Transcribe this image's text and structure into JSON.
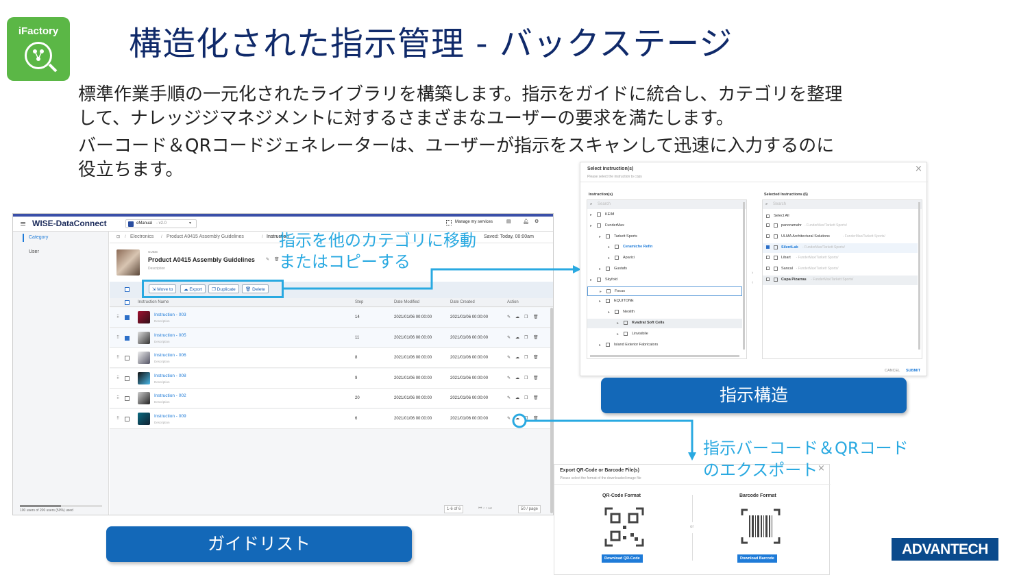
{
  "header": {
    "logo_text": "iFactory",
    "title": "構造化された指示管理 - バックステージ",
    "desc_line1": "標準作業手順の一元化されたライブラリを構築します。指示をガイドに統合し、カテゴリを整理",
    "desc_line2": "して、ナレッジジマネジメントに対するさまざまなユーザーの要求を満たします。",
    "desc_line3": "バーコード＆QRコードジェネレーターは、ユーザーが指示をスキャンして迅速に入力するのに",
    "desc_line4": "役立ちます。"
  },
  "app": {
    "brand": "WISE-DataConnect",
    "app_select": "eManual",
    "app_version": "- v2.0",
    "manage_services": "Manage my services",
    "sidebar": {
      "category": "Category",
      "user": "User",
      "usage": "100 users of 200 users (50%) used"
    },
    "breadcrumb": [
      "Electronics",
      "Product A0415 Assembly Guidelines",
      "Instruction"
    ],
    "last_saved": "Saved: Today, 00:00am",
    "guide": {
      "tag": "GUIDE",
      "name": "Product A0415 Assembly Guidelines",
      "description": "Description"
    },
    "toolbar": {
      "move": "Move to",
      "export": "Export",
      "duplicate": "Duplicate",
      "delete": "Delete"
    },
    "columns": {
      "name": "Instruction Name",
      "step": "Step",
      "modified": "Date Modified",
      "created": "Date Created",
      "action": "Action"
    },
    "rows": [
      {
        "name": "Instruction - 003",
        "desc": "Description",
        "step": "14",
        "modified": "2021/01/06 00:00:00",
        "created": "2021/01/06 00:00:00",
        "checked": true
      },
      {
        "name": "Instruction - 005",
        "desc": "Description",
        "step": "11",
        "modified": "2021/01/06 00:00:00",
        "created": "2021/01/06 00:00:00",
        "checked": true
      },
      {
        "name": "Instruction - 006",
        "desc": "Description",
        "step": "8",
        "modified": "2021/01/06 00:00:00",
        "created": "2021/01/06 00:00:00",
        "checked": false
      },
      {
        "name": "Instruction - 008",
        "desc": "Description",
        "step": "9",
        "modified": "2021/01/06 00:00:00",
        "created": "2021/01/06 00:00:00",
        "checked": false
      },
      {
        "name": "Instruction - 002",
        "desc": "Description",
        "step": "20",
        "modified": "2021/01/06 00:00:00",
        "created": "2021/01/06 00:00:00",
        "checked": false
      },
      {
        "name": "Instruction - 009",
        "desc": "Description",
        "step": "6",
        "modified": "2021/01/06 00:00:00",
        "created": "2021/01/06 00:00:00",
        "checked": false
      }
    ],
    "pagination": {
      "range": "1-6 of 6",
      "per_page": "50 / page"
    }
  },
  "callouts": {
    "move_copy_1": "指示を他のカテゴリに移動",
    "move_copy_2": "またはコピーする",
    "barcode_1": "指示バーコード＆QRコード",
    "barcode_2": "のエクスポート"
  },
  "pills": {
    "guide_list": "ガイドリスト",
    "instruction_structure": "指示構造"
  },
  "select_dialog": {
    "title": "Select Instruction(s)",
    "subtitle": "Please select the instruction to copy",
    "left_header": "Instruction(s)",
    "right_header": "Selected Instructions (6)",
    "search_placeholder": "Search",
    "tree": [
      "KEIM",
      "FunderMax",
      "Tarkett Sports",
      "Ceramiche Refin",
      "Aparici",
      "Gustafs",
      "Skyfold",
      "Focus",
      "EQUITONE",
      "Neolith",
      "Kvadrat Soft Cells",
      "Linvisibile",
      "Island Exterior Fabricators"
    ],
    "select_all": "Select All",
    "selected": [
      {
        "name": "panoramahr",
        "path": "- FunderMax/Tarkett Sports/"
      },
      {
        "name": "ULMA Architectural Solutions",
        "path": "- FunderMax/Tarkett Sports/"
      },
      {
        "name": "SilentLab",
        "path": "- FunderMax/Tarkett Sports/"
      },
      {
        "name": "Libart",
        "path": "- FunderMax/Tarkett Sports/"
      },
      {
        "name": "Sancal",
        "path": "- FunderMax/Tarkett Sports/"
      },
      {
        "name": "Cupa Pizarras",
        "path": "- FunderMax/Tarkett Sports/"
      }
    ],
    "cancel": "CANCEL",
    "submit": "SUBMIT"
  },
  "export_dialog": {
    "title": "Export QR-Code or Barcode File(s)",
    "subtitle": "Please select the format of the downloaded image file",
    "qr_format": "QR-Code Format",
    "barcode_format": "Barcode Format",
    "or": "or",
    "download_qr": "Download QR-Code",
    "download_barcode": "Download Barcode"
  },
  "brand_footer": "ADVANTECH",
  "colors": {
    "accent_blue": "#1368b8",
    "callout_cyan": "#29a9e1",
    "title_navy": "#102a6a",
    "logo_green": "#5bb746"
  }
}
